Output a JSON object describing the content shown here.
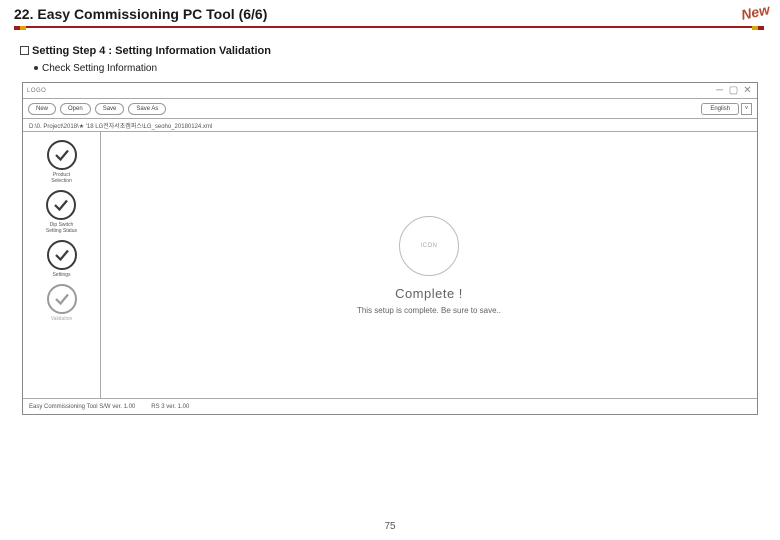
{
  "header": {
    "title": "22. Easy Commissioning PC Tool (6/6)",
    "badge": "New"
  },
  "section": {
    "heading": "Setting Step 4 : Setting Information Validation",
    "subline": "Check Setting Information"
  },
  "tool": {
    "titlebar": {
      "logo": "LOGO"
    },
    "toolbar": {
      "new_label": "New",
      "open_label": "Open",
      "save_label": "Save",
      "saveas_label": "Save As",
      "language_label": "English"
    },
    "db_path": "D:\\0. Project\\2018\\★ '18 LG전자서초캠퍼스\\LG_seoho_20180124.xml",
    "steps": [
      {
        "label": "Product\nSelection"
      },
      {
        "label": "Dip Switch\nSetting Status"
      },
      {
        "label": "Settings"
      },
      {
        "label": "Validation"
      }
    ],
    "content": {
      "icon_label": "ICON",
      "complete_title": "Complete !",
      "complete_sub": "This setup is complete. Be sure to save.."
    },
    "status": {
      "tool_ver": "Easy Commissioning Tool S/W ver. 1.00",
      "rs3_ver": "RS 3 ver. 1.00"
    }
  },
  "page_number": "75"
}
